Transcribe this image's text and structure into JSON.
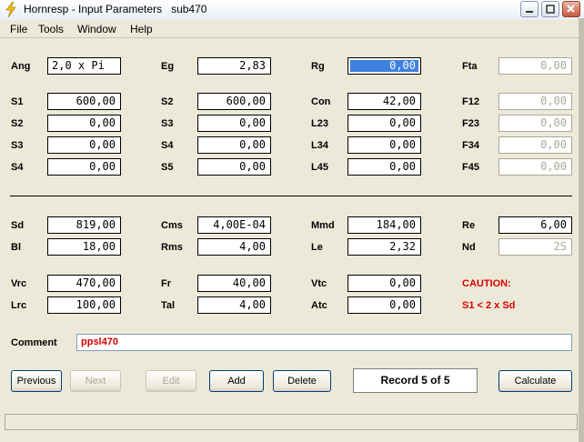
{
  "window": {
    "title": "Hornresp - Input Parameters   sub470",
    "minimize_icon": "minimize-icon",
    "maximize_icon": "maximize-icon",
    "close_icon": "close-icon"
  },
  "menu": {
    "file": "File",
    "tools": "Tools",
    "window": "Window",
    "help": "Help"
  },
  "params": {
    "ang": {
      "label": "Ang",
      "value": "2,0 x Pi"
    },
    "eg": {
      "label": "Eg",
      "value": "2,83"
    },
    "rg": {
      "label": "Rg",
      "value": "0,00"
    },
    "fta": {
      "label": "Fta",
      "value": "0,00"
    },
    "s1a": {
      "label": "S1",
      "value": "600,00"
    },
    "s2a": {
      "label": "S2",
      "value": "600,00"
    },
    "con": {
      "label": "Con",
      "value": "42,00"
    },
    "f12": {
      "label": "F12",
      "value": "0,00"
    },
    "s2b": {
      "label": "S2",
      "value": "0,00"
    },
    "s3a": {
      "label": "S3",
      "value": "0,00"
    },
    "l23": {
      "label": "L23",
      "value": "0,00"
    },
    "f23": {
      "label": "F23",
      "value": "0,00"
    },
    "s3b": {
      "label": "S3",
      "value": "0,00"
    },
    "s4a": {
      "label": "S4",
      "value": "0,00"
    },
    "l34": {
      "label": "L34",
      "value": "0,00"
    },
    "f34": {
      "label": "F34",
      "value": "0,00"
    },
    "s4b": {
      "label": "S4",
      "value": "0,00"
    },
    "s5": {
      "label": "S5",
      "value": "0,00"
    },
    "l45": {
      "label": "L45",
      "value": "0,00"
    },
    "f45": {
      "label": "F45",
      "value": "0,00"
    },
    "sd": {
      "label": "Sd",
      "value": "819,00"
    },
    "cms": {
      "label": "Cms",
      "value": "4,00E-04"
    },
    "mmd": {
      "label": "Mmd",
      "value": "184,00"
    },
    "re": {
      "label": "Re",
      "value": "6,00"
    },
    "bl": {
      "label": "Bl",
      "value": "18,00"
    },
    "rms": {
      "label": "Rms",
      "value": "4,00"
    },
    "le": {
      "label": "Le",
      "value": "2,32"
    },
    "nd": {
      "label": "Nd",
      "value": "2S"
    },
    "vrc": {
      "label": "Vrc",
      "value": "470,00"
    },
    "fr": {
      "label": "Fr",
      "value": "40,00"
    },
    "vtc": {
      "label": "Vtc",
      "value": "0,00"
    },
    "lrc": {
      "label": "Lrc",
      "value": "100,00"
    },
    "tal": {
      "label": "Tal",
      "value": "4,00"
    },
    "atc": {
      "label": "Atc",
      "value": "0,00"
    }
  },
  "caution": {
    "title": "CAUTION:",
    "message": "S1 < 2 x Sd"
  },
  "comment": {
    "label": "Comment",
    "value": "ppsl470"
  },
  "buttons": {
    "previous": "Previous",
    "next": "Next",
    "edit": "Edit",
    "add": "Add",
    "delete": "Delete",
    "calculate": "Calculate"
  },
  "record_status": "Record 5 of 5",
  "colors": {
    "caution": "#e00000",
    "comment_text": "#d40000",
    "selection": "#3d80df",
    "disabled": "#aca899"
  }
}
